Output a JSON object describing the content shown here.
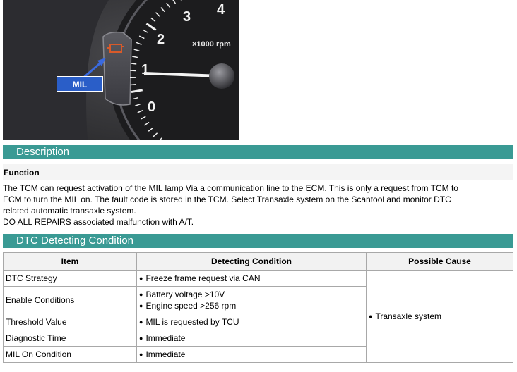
{
  "photo": {
    "tach_numbers": [
      "0",
      "1",
      "2",
      "3",
      "4"
    ],
    "tach_unit": "×1000 rpm",
    "mil_callout": "MIL"
  },
  "description": {
    "section_title": "Description",
    "function_heading": "Function",
    "lines": [
      "The TCM can request activation of the MIL lamp Via a communication line to the ECM. This is only a request from TCM to",
      "ECM to turn the MIL on. The fault code is stored in the TCM. Select Transaxle system on the Scantool and monitor DTC",
      "related automatic transaxle system.",
      "DO ALL REPAIRS associated malfunction with A/T."
    ]
  },
  "dtc": {
    "section_title": "DTC Detecting Condition",
    "columns": [
      "Item",
      "Detecting Condition",
      "Possible Cause"
    ],
    "rows": [
      {
        "item": "DTC Strategy",
        "conditions": [
          "Freeze frame request via CAN"
        ]
      },
      {
        "item": "Enable Conditions",
        "conditions": [
          "Battery voltage >10V",
          "Engine speed >256 rpm"
        ]
      },
      {
        "item": "Threshold Value",
        "conditions": [
          "MIL is requested by TCU"
        ]
      },
      {
        "item": "Diagnostic Time",
        "conditions": [
          "Immediate"
        ]
      },
      {
        "item": "MIL On Condition",
        "conditions": [
          "Immediate"
        ]
      }
    ],
    "possible_cause": "Transaxle system"
  },
  "colors": {
    "section_bar": "#3a9a94",
    "mil_label_bg": "#2a5ec8",
    "mil_lamp": "#d85a2a"
  }
}
